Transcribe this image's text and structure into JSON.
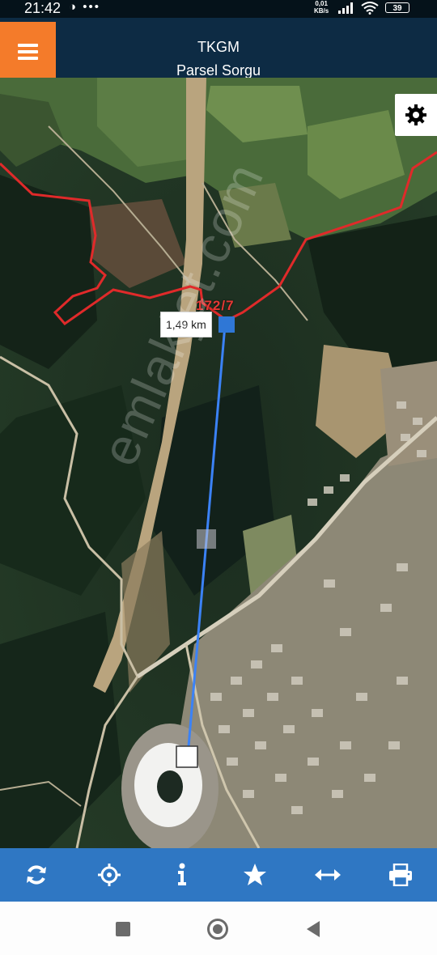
{
  "status_bar": {
    "time": "21:42",
    "notification_icons": "◑ •••",
    "net_speed_value": "0,01",
    "net_speed_unit": "KB/s",
    "battery": "39"
  },
  "header": {
    "title": "TKGM",
    "subtitle": "Parsel Sorgu",
    "accent_color": "#f47b2a",
    "bar_color": "#0d2b44"
  },
  "map": {
    "parcel_label": "172/7",
    "distance_label": "1,49 km",
    "watermark": "emlakjet.com",
    "boundary_color": "#e02a2a",
    "measure_line_color": "#3b82f6"
  },
  "toolbar": {
    "color": "#2f77c3",
    "items": [
      {
        "icon": "refresh-icon"
      },
      {
        "icon": "locate-icon"
      },
      {
        "icon": "info-icon"
      },
      {
        "icon": "star-icon"
      },
      {
        "icon": "measure-icon"
      },
      {
        "icon": "print-icon"
      }
    ]
  },
  "nav": {
    "items": [
      {
        "icon": "recents-icon"
      },
      {
        "icon": "home-icon"
      },
      {
        "icon": "back-icon"
      }
    ]
  }
}
